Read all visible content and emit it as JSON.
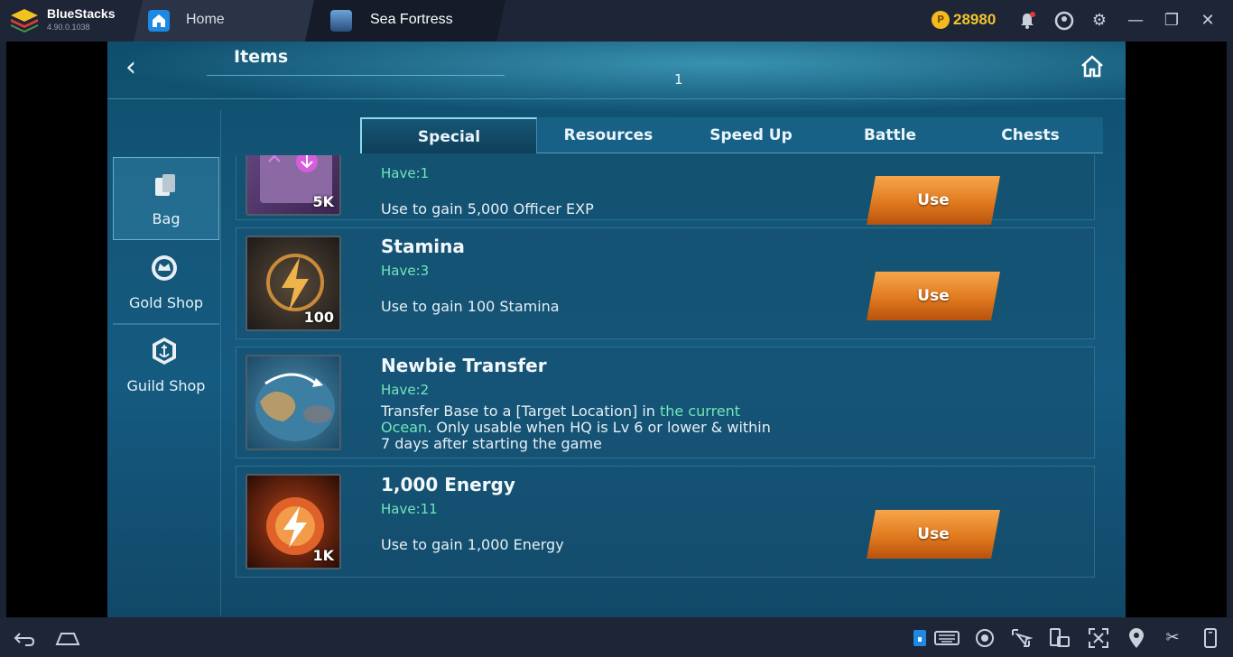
{
  "emulator": {
    "brand": "BlueStacks",
    "version": "4.90.0.1038",
    "tabs": [
      {
        "label": "Home",
        "icon": "home-icon"
      },
      {
        "label": "Sea Fortress",
        "icon": "game-icon"
      }
    ],
    "coins": "28980",
    "coin_symbol": "P"
  },
  "game": {
    "title": "Items",
    "page_number": "1",
    "sidenav": [
      {
        "label": "Bag",
        "icon": "bag-icon",
        "active": true
      },
      {
        "label": "Gold Shop",
        "icon": "crown-icon",
        "active": false
      },
      {
        "label": "Guild Shop",
        "icon": "anchor-shield-icon",
        "active": false
      }
    ],
    "tabs": [
      {
        "label": "Special",
        "active": true
      },
      {
        "label": "Resources",
        "active": false
      },
      {
        "label": "Speed Up",
        "active": false
      },
      {
        "label": "Battle",
        "active": false
      },
      {
        "label": "Chests",
        "active": false
      }
    ],
    "items": [
      {
        "name": "",
        "have": "Have:1",
        "desc": "Use to gain 5,000 Officer EXP",
        "qty": "5K",
        "button": "Use"
      },
      {
        "name": "Stamina",
        "have": "Have:3",
        "desc": "Use to gain 100 Stamina",
        "qty": "100",
        "button": "Use"
      },
      {
        "name": "Newbie Transfer",
        "have": "Have:2",
        "desc_part1": "Transfer Base to a [Target Location] in ",
        "desc_highlight": "the current Ocean",
        "desc_part2": ". Only usable when HQ is Lv 6 or lower & within 7 days after starting the game",
        "qty": ""
      },
      {
        "name": "1,000 Energy",
        "have": "Have:11",
        "desc": "Use to gain 1,000 Energy",
        "qty": "1K",
        "button": "Use"
      }
    ]
  }
}
